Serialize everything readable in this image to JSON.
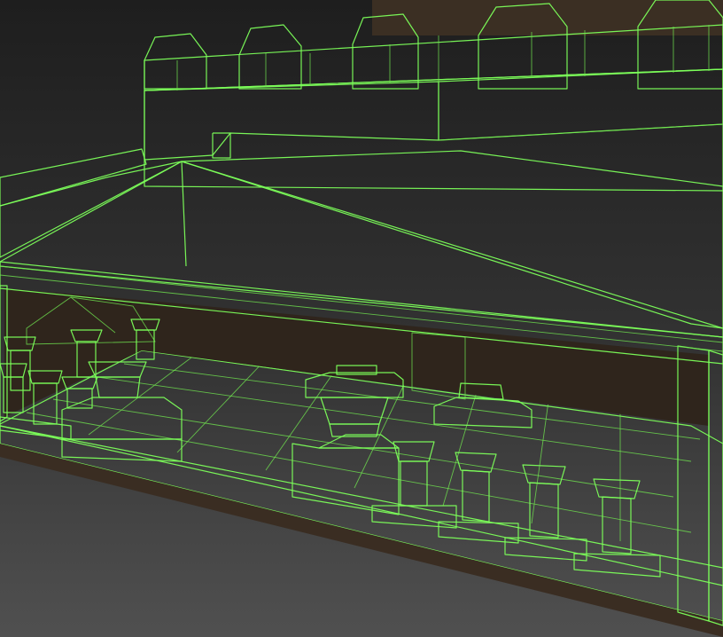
{
  "viewport": {
    "background_top": "#1f1f1f",
    "background_bottom": "#4a4a4a",
    "wire_color": "#7cff5a"
  },
  "model": {
    "material_dark": "#3a2e22",
    "material_mid": "#4a3828",
    "material_light": "#5b4536"
  }
}
